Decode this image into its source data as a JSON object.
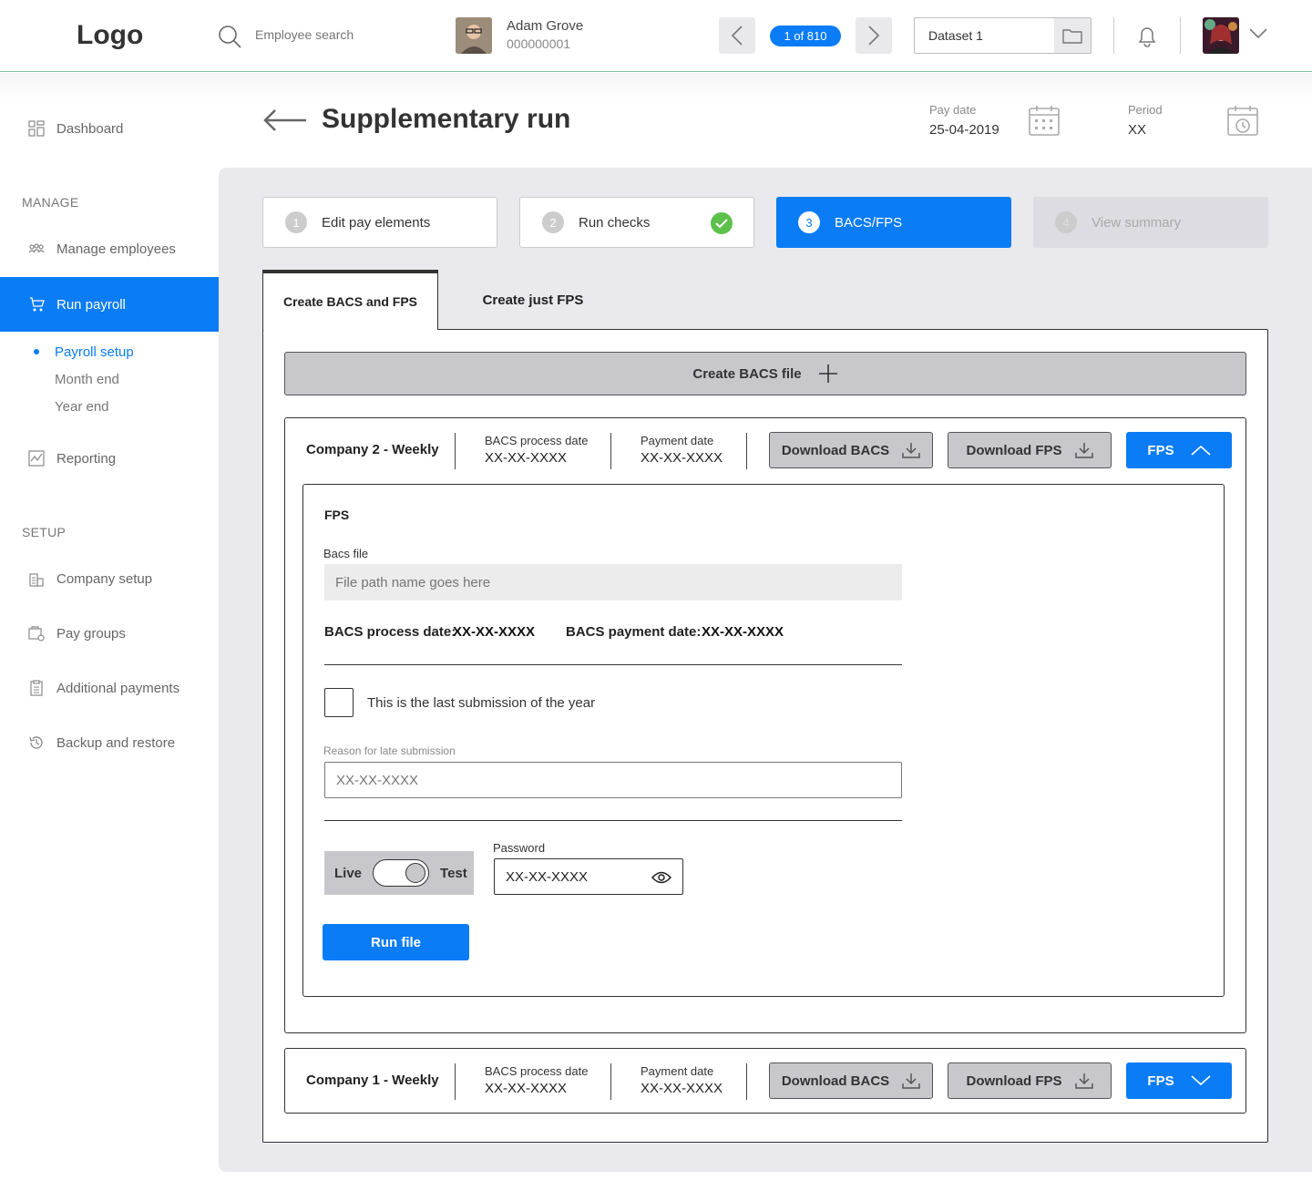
{
  "topbar": {
    "logo": "Logo",
    "search_placeholder": "Employee search",
    "employee_name": "Adam Grove",
    "employee_id": "000000001",
    "counter": "1 of 810",
    "dataset": "Dataset 1"
  },
  "sidebar": {
    "dashboard": "Dashboard",
    "manage_heading": "MANAGE",
    "manage_employees": "Manage employees",
    "run_payroll": "Run payroll",
    "payroll_setup": "Payroll setup",
    "month_end": "Month end",
    "year_end": "Year end",
    "reporting": "Reporting",
    "setup_heading": "SETUP",
    "company_setup": "Company setup",
    "pay_groups": "Pay groups",
    "additional_payments": "Additional payments",
    "backup_restore": "Backup and restore"
  },
  "header": {
    "title": "Supplementary run",
    "pay_date_label": "Pay date",
    "pay_date": "25-04-2019",
    "period_label": "Period",
    "period": "XX"
  },
  "steps": [
    {
      "num": "1",
      "label": "Edit pay elements"
    },
    {
      "num": "2",
      "label": "Run checks"
    },
    {
      "num": "3",
      "label": "BACS/FPS"
    },
    {
      "num": "4",
      "label": "View summary"
    }
  ],
  "tabs": {
    "tab1": "Create BACS and FPS",
    "tab2": "Create just FPS"
  },
  "create_bacs": "Create BACS file",
  "companies": [
    {
      "name": "Company 2 - Weekly",
      "bacs_label": "BACS process date",
      "bacs_value": "XX-XX-XXXX",
      "payment_label": "Payment date",
      "payment_value": "XX-XX-XXXX",
      "download_bacs": "Download BACS",
      "download_fps": "Download FPS",
      "fps": "FPS"
    },
    {
      "name": "Company 1 - Weekly",
      "bacs_label": "BACS process date",
      "bacs_value": "XX-XX-XXXX",
      "payment_label": "Payment date",
      "payment_value": "XX-XX-XXXX",
      "download_bacs": "Download BACS",
      "download_fps": "Download FPS",
      "fps": "FPS"
    }
  ],
  "fps_panel": {
    "title": "FPS",
    "bacs_file_label": "Bacs file",
    "bacs_file_placeholder": "File path name goes here",
    "bacs_process_label": "BACS process date:",
    "bacs_process_value": "XX-XX-XXXX",
    "bacs_payment_label": "BACS payment date:",
    "bacs_payment_value": "XX-XX-XXXX",
    "last_submission": "This is the last submission of the year",
    "late_label": "Reason for late submission",
    "late_placeholder": "XX-XX-XXXX",
    "live": "Live",
    "test": "Test",
    "password_label": "Password",
    "password_value": "XX-XX-XXXX",
    "run_file": "Run file"
  },
  "colors": {
    "accent": "#0a7cf5",
    "success": "#5cc04a",
    "content_bg": "#e9e9ee"
  }
}
